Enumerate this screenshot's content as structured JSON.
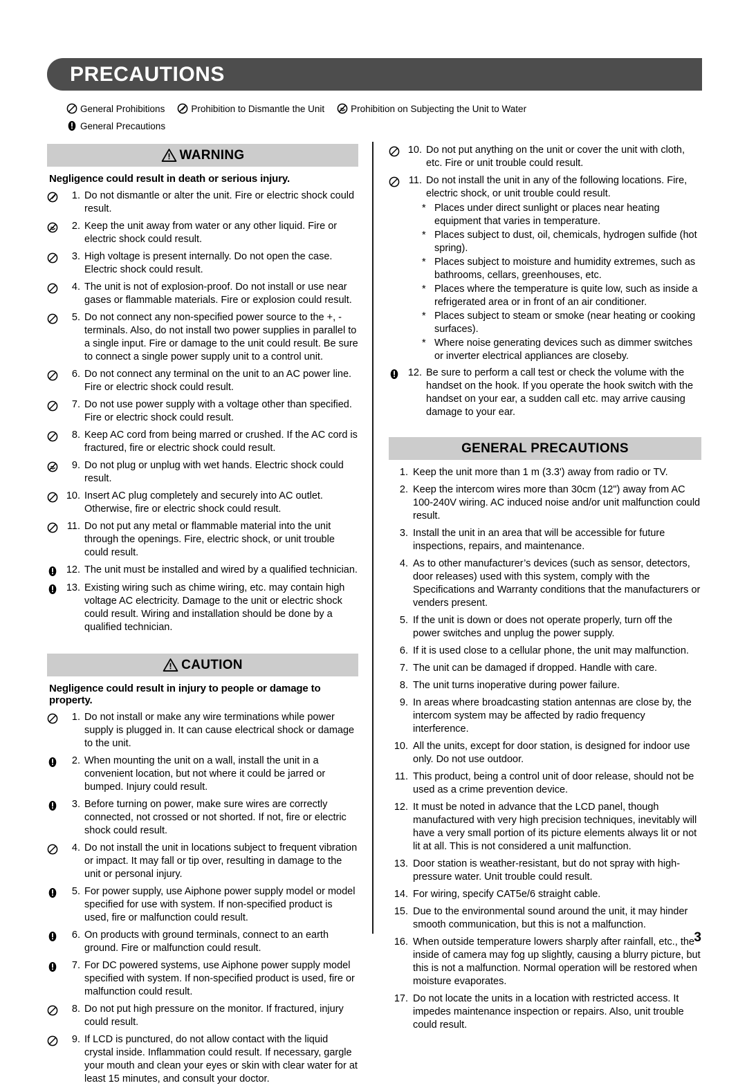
{
  "page": {
    "title": "PRECAUTIONS",
    "page_number": "3",
    "colors": {
      "title_bar": "#4d4d4d",
      "section_bar": "#cccccc",
      "text": "#000000",
      "divider": "#1a1a1a"
    }
  },
  "legend": {
    "row1": [
      {
        "icon": "general-prohibition-icon",
        "label": "General Prohibitions"
      },
      {
        "icon": "prohibition-dismantle-icon",
        "label": "Prohibition to Dismantle the Unit"
      },
      {
        "icon": "prohibition-water-icon",
        "label": "Prohibition on Subjecting the Unit to Water"
      }
    ],
    "row2": [
      {
        "icon": "general-precaution-icon",
        "label": "General Precautions"
      }
    ]
  },
  "warning": {
    "bar_title": "WARNING",
    "lead": "Negligence could result in death or serious injury.",
    "items": [
      {
        "num": "1.",
        "icon": "prohibition-dismantle-icon",
        "text": "Do not dismantle or alter the unit. Fire or electric shock could result."
      },
      {
        "num": "2.",
        "icon": "prohibition-water-icon",
        "text": "Keep the unit away from water or any other liquid. Fire or electric shock could result."
      },
      {
        "num": "3.",
        "icon": "general-prohibition-icon",
        "text": "High voltage is present internally. Do not open the case. Electric shock could result."
      },
      {
        "num": "4.",
        "icon": "general-prohibition-icon",
        "text": "The unit is not of explosion-proof. Do not install or use near gases or flammable materials. Fire or explosion could result."
      },
      {
        "num": "5.",
        "icon": "general-prohibition-icon",
        "text": "Do not connect any non-specified power source to the +, - terminals. Also, do not install two power supplies in parallel to a single input. Fire or damage to the unit could result. Be sure to connect a single power supply unit to a control unit."
      },
      {
        "num": "6.",
        "icon": "general-prohibition-icon",
        "text": "Do not connect any terminal on the unit to an AC power line. Fire or electric shock could result."
      },
      {
        "num": "7.",
        "icon": "general-prohibition-icon",
        "text": "Do not use power supply with a voltage other than specified. Fire or electric shock could result."
      },
      {
        "num": "8.",
        "icon": "general-prohibition-icon",
        "text": "Keep AC cord from being marred or crushed. If the AC cord is fractured, fire or electric shock could result."
      },
      {
        "num": "9.",
        "icon": "prohibition-water-icon",
        "text": "Do not plug or unplug with wet hands. Electric shock could result."
      },
      {
        "num": "10.",
        "icon": "general-prohibition-icon",
        "text": "Insert AC plug completely and securely into AC outlet. Otherwise, fire or electric shock could result."
      },
      {
        "num": "11.",
        "icon": "general-prohibition-icon",
        "text": "Do not put any metal or flammable material into the unit through the openings. Fire, electric shock, or unit trouble could result."
      },
      {
        "num": "12.",
        "icon": "general-precaution-icon",
        "text": "The unit must be installed and wired by a qualified technician."
      },
      {
        "num": "13.",
        "icon": "general-precaution-icon",
        "text": "Existing wiring such as chime wiring, etc. may contain high voltage AC electricity. Damage to the unit or electric shock could result. Wiring and installation should be done by a qualified technician."
      }
    ],
    "items_right": [
      {
        "num": "10.",
        "icon": "general-prohibition-icon",
        "text": "Do not put anything on the unit or cover the unit with cloth, etc. Fire or unit trouble could result."
      },
      {
        "num": "11.",
        "icon": "general-prohibition-icon",
        "text": "Do not install the unit in any of the following locations. Fire, electric shock, or unit trouble could result."
      }
    ],
    "location_sublist": [
      "Places under direct sunlight or places near heating equipment that varies in temperature.",
      "Places subject to dust, oil, chemicals, hydrogen sulfide (hot spring).",
      "Places subject to moisture and humidity extremes, such as bathrooms, cellars, greenhouses, etc.",
      "Places where the temperature is quite low, such as inside a refrigerated area or in front of an air conditioner.",
      "Places subject to steam or smoke (near heating or cooking surfaces).",
      "Where noise generating devices such as dimmer switches or inverter electrical appliances are closeby."
    ],
    "item12_right": {
      "num": "12.",
      "icon": "general-precaution-icon",
      "text": "Be sure to perform a call test or check the volume with the handset on the hook. If you operate the hook switch with the handset on your ear, a sudden call etc. may arrive causing damage to your ear."
    }
  },
  "caution": {
    "bar_title": "CAUTION",
    "lead": "Negligence could result in injury to people or damage to property.",
    "items": [
      {
        "num": "1.",
        "icon": "general-prohibition-icon",
        "text": "Do not install or make any wire terminations while power supply is plugged in. It can cause electrical shock or damage to the unit."
      },
      {
        "num": "2.",
        "icon": "general-precaution-icon",
        "text": "When mounting the unit on a wall, install the unit in a convenient location, but not where it could be jarred or bumped. Injury could result."
      },
      {
        "num": "3.",
        "icon": "general-precaution-icon",
        "text": "Before turning on power, make sure wires are correctly connected, not crossed or not shorted. If not, fire or electric shock could result."
      },
      {
        "num": "4.",
        "icon": "general-prohibition-icon",
        "text": "Do not install the unit in locations subject to frequent vibration or impact. It may fall or tip over, resulting in damage to the unit or personal injury."
      },
      {
        "num": "5.",
        "icon": "general-precaution-icon",
        "text": "For power supply, use Aiphone power supply model or model specified for use with system. If non-specified product is used, fire or malfunction could result."
      },
      {
        "num": "6.",
        "icon": "general-precaution-icon",
        "text": "On products with ground terminals, connect to an earth ground. Fire or malfunction could result."
      },
      {
        "num": "7.",
        "icon": "general-precaution-icon",
        "text": "For DC powered systems, use Aiphone power supply model specified with system. If non-specified product is used, fire or malfunction could result."
      },
      {
        "num": "8.",
        "icon": "general-prohibition-icon",
        "text": "Do not put high pressure on the monitor. If fractured, injury could result."
      },
      {
        "num": "9.",
        "icon": "general-prohibition-icon",
        "text": "If LCD is punctured, do not allow contact with the liquid crystal inside. Inflammation could result. If necessary, gargle your mouth and clean your eyes or skin with clear water for at least 15 minutes, and consult your doctor."
      }
    ]
  },
  "general_precautions": {
    "bar_title": "GENERAL PRECAUTIONS",
    "items": [
      {
        "num": "1.",
        "text": "Keep the unit more than 1 m (3.3') away from radio or TV."
      },
      {
        "num": "2.",
        "text": "Keep the intercom wires more than 30cm (12\")  away from AC 100-240V wiring. AC induced noise and/or unit malfunction could result."
      },
      {
        "num": "3.",
        "text": "Install the unit in an area that will be accessible for future inspections, repairs, and maintenance."
      },
      {
        "num": "4.",
        "text": "As to other manufacturer’s devices (such as sensor, detectors, door releases) used with this system, comply with the Specifications and Warranty conditions that the manufacturers or venders present."
      },
      {
        "num": "5.",
        "text": "If the unit is down or does not operate properly, turn off the power switches and unplug the power supply."
      },
      {
        "num": "6.",
        "text": "If it is used close to a cellular phone, the unit may malfunction."
      },
      {
        "num": "7.",
        "text": "The unit can be damaged if dropped. Handle with care."
      },
      {
        "num": "8.",
        "text": "The unit turns inoperative during power failure."
      },
      {
        "num": "9.",
        "text": "In areas where broadcasting station antennas are close by, the intercom system may be affected by radio frequency interference."
      },
      {
        "num": "10.",
        "text": "All the units, except for door station, is designed for indoor use only. Do not use outdoor."
      },
      {
        "num": "11.",
        "text": "This product, being a control unit of door release, should not be used as a crime prevention device."
      },
      {
        "num": "12.",
        "text": "It must be noted in advance that the LCD panel, though manufactured with very high precision techniques, inevitably will have a very small portion of its picture elements always lit or not lit at all. This is not considered a unit malfunction."
      },
      {
        "num": "13.",
        "text": "Door station is weather-resistant, but do not spray with high-pressure water. Unit trouble could result."
      },
      {
        "num": "14.",
        "text": "For wiring, specify CAT5e/6 straight cable."
      },
      {
        "num": "15.",
        "text": "Due to the environmental sound around the unit, it may hinder smooth communication, but this is not a malfunction."
      },
      {
        "num": "16.",
        "text": "When outside temperature lowers sharply after rainfall, etc., the inside of camera may fog up slightly, causing a blurry picture, but this is not a malfunction. Normal operation will be restored when moisture evaporates."
      },
      {
        "num": "17.",
        "text": "Do not locate the units in a location with restricted access. It impedes maintenance inspection or repairs. Also, unit trouble could result."
      }
    ]
  }
}
